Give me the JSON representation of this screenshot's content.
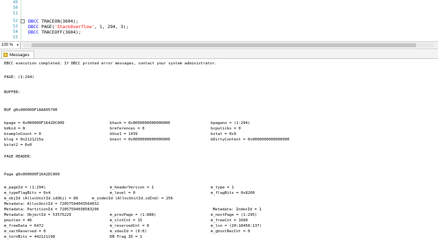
{
  "editor": {
    "line_numbers": [
      "49",
      "50",
      "51",
      "52",
      "53",
      "54",
      "55"
    ],
    "code": {
      "line52": {
        "kw": "DBCC",
        "rest": " TRACEON(3604);"
      },
      "line53": {
        "kw": "DBCC",
        "pre": " PAGE(",
        "str": "'StackOverflow'",
        "post": ", 1, 294, 3);"
      },
      "line54": {
        "kw": "DBCC",
        "rest": " TRACEOFF(3604);"
      }
    },
    "fold_symbol": "-"
  },
  "zoom": {
    "value": "100 %",
    "arrow": "▾"
  },
  "tabs": {
    "messages": "Messages"
  },
  "output": {
    "l1": "DBCC execution completed. If DBCC printed error messages, contact your system administrator.",
    "l2": "PAGE: (1:294)",
    "l3": "BUFFER:",
    "l4": "BUF @0x000000F18A805700",
    "r1": [
      "bpage = 0x000000F1642DC000",
      "bhash = 0x0000000000000000",
      "bpageno = (1:294)"
    ],
    "r2": [
      "bdbid = 8",
      "breferences = 0",
      "bcputicks = 0"
    ],
    "r3": [
      "bsampleCount = 0",
      "bUse1 = 1439",
      "bstat = 0x9"
    ],
    "r4": [
      "blog = 0x2121215a",
      "bnext = 0x0000000000000000",
      "bDirtyContext = 0x0000000000000000"
    ],
    "r5": [
      "bstat2 = 0x0"
    ],
    "l5": "PAGE HEADER:",
    "l6": "Page @0x000000F1642DC000",
    "h1": [
      "m_pageId = (1:294)",
      "m_headerVersion = 1",
      "m_type = 1"
    ],
    "h2": [
      "m_typeFlagBits = 0x4",
      "m_level = 0",
      "m_flagBits = 0x8200"
    ],
    "h3": "m_objId (AllocUnitId.idObj) = 86      m_indexId (AllocUnitId.idInd) = 256",
    "h4": "Metadata: AllocUnitId = 72057594043564032",
    "h5a": "Metadata: PartitionId = 72057594038583296",
    "h5b": "Metadata: IndexId = 1",
    "h6": [
      "Metadata: ObjectId = 53575229",
      "m_prevPage = (1:888)",
      "m_nextPage = (1:295)"
    ],
    "h7": [
      "pminlen = 46",
      "m_slotCnt = 15",
      "m_freeCnt = 1690"
    ],
    "h8": [
      "m_freeData = 6472",
      "m_reservedCnt = 0",
      "m_lsn = (20:18458:137)"
    ],
    "h9": [
      "m_xactReserved = 0",
      "m_xdesId = (0:0)",
      "m_ghostRecCnt = 0"
    ],
    "h10": [
      "m_tornBits = 442121198",
      "DB Frag ID = 1"
    ]
  }
}
